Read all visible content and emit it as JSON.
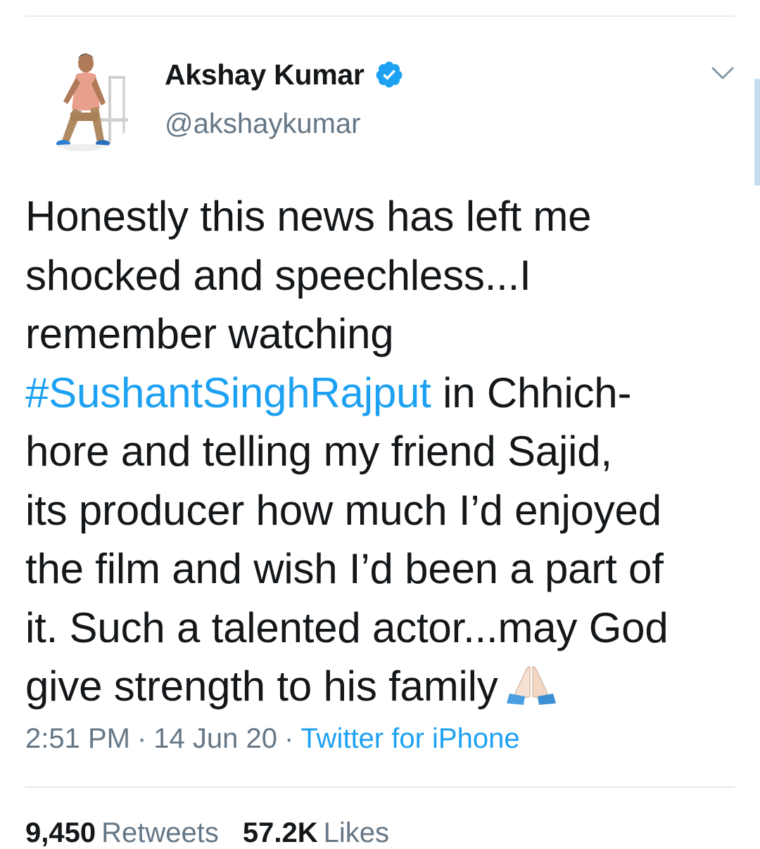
{
  "tweet": {
    "author": {
      "display_name": "Akshay Kumar",
      "handle": "@akshaykumar",
      "verified": true
    },
    "text_lines": [
      {
        "plain": "Honestly this news has left me"
      },
      {
        "plain": "shocked and speechless...I"
      },
      {
        "plain": "remember watching"
      },
      {
        "hashtag": "#SushantSinghRajput",
        "plain": " in Chhich-"
      },
      {
        "plain": "hore and telling my friend Sajid,"
      },
      {
        "plain": "its producer how much I’d enjoyed"
      },
      {
        "plain": "the film and wish I’d been a part of"
      },
      {
        "plain": "it. Such a talented actor...may God"
      },
      {
        "plain": "give strength to his family"
      }
    ],
    "emoji_icon": "folded-hands-icon",
    "meta": {
      "time": "2:51 PM",
      "separator": "·",
      "date": "14 Jun 20",
      "source": "Twitter for iPhone"
    },
    "stats": {
      "retweets_count": "9,450",
      "retweets_label": "Retweets",
      "likes_count": "57.2K",
      "likes_label": "Likes"
    }
  },
  "colors": {
    "link": "#1da1f2",
    "secondary_text": "#657786",
    "primary_text": "#14171a",
    "divider": "#e6ecf0"
  }
}
